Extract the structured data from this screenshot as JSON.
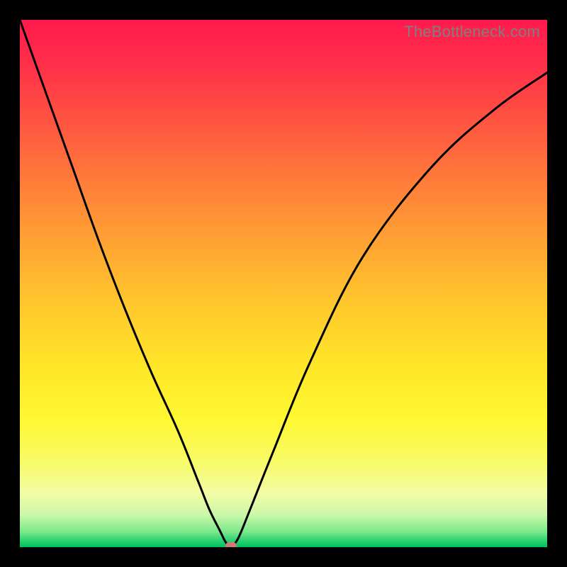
{
  "watermark": "TheBottleneck.com",
  "colors": {
    "curve": "#000000",
    "marker": "#cf7a77",
    "frame": "#000000"
  },
  "chart_data": {
    "type": "line",
    "title": "",
    "xlabel": "",
    "ylabel": "",
    "xlim": [
      0,
      100
    ],
    "ylim": [
      0,
      100
    ],
    "gradient_description": "vertical red→orange→yellow→green",
    "series": [
      {
        "name": "bottleneck-curve",
        "x": [
          0,
          5,
          10,
          15,
          20,
          25,
          30,
          34,
          36,
          38,
          39,
          40,
          41,
          42,
          44,
          48,
          55,
          65,
          78,
          90,
          100
        ],
        "y": [
          100,
          86,
          72,
          58,
          45,
          33,
          22,
          12,
          7,
          3,
          1,
          0,
          1,
          3,
          8,
          18,
          35,
          55,
          72,
          83,
          90
        ]
      }
    ],
    "minimum_marker": {
      "x": 40,
      "y": 0
    }
  }
}
